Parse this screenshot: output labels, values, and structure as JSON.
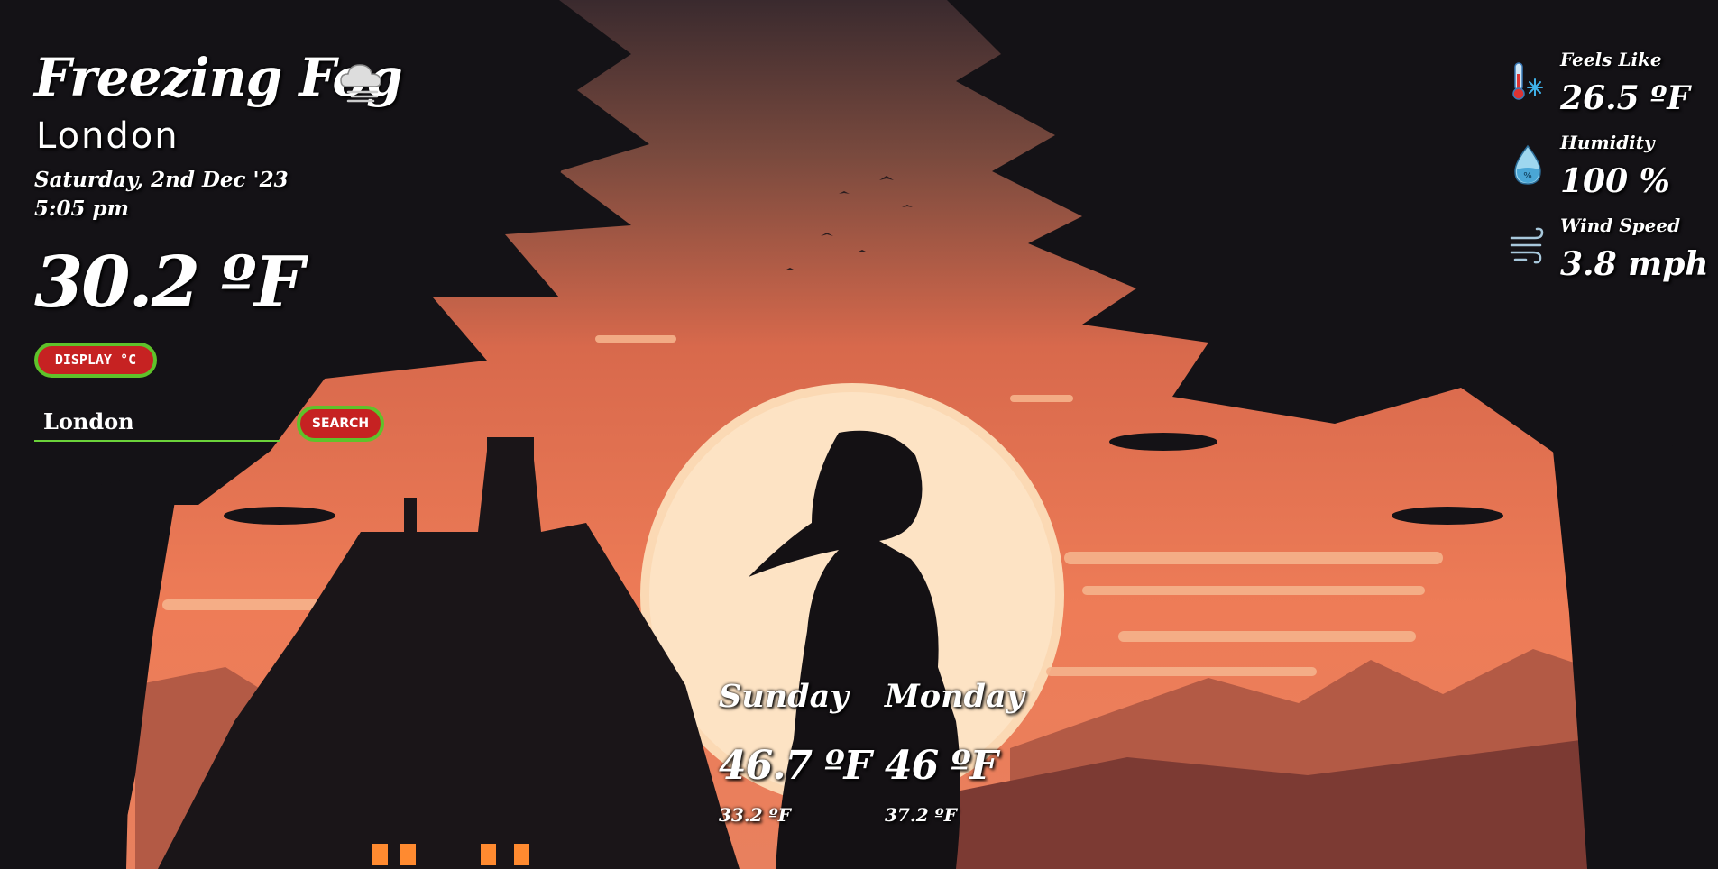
{
  "weather": {
    "condition": "Freezing Fog",
    "condition_icon": "cloud-fog-icon",
    "city": "London",
    "date": "Saturday, 2nd Dec '23",
    "time": "5:05 pm",
    "temperature": "30.2 ºF"
  },
  "controls": {
    "unit_toggle_label": "DISPLAY °C",
    "search_value": "London",
    "search_button_label": "SEARCH"
  },
  "details": [
    {
      "icon": "thermometer-snowflake-icon",
      "label": "Feels Like",
      "value": "26.5 ºF"
    },
    {
      "icon": "humidity-drop-icon",
      "label": "Humidity",
      "value": "100 %"
    },
    {
      "icon": "wind-icon",
      "label": "Wind Speed",
      "value": "3.8 mph"
    }
  ],
  "forecast": [
    {
      "day": "Sunday",
      "high": "46.7 ºF",
      "low": "33.2 ºF"
    },
    {
      "day": "Monday",
      "high": "46 ºF",
      "low": "37.2 ºF"
    }
  ],
  "colors": {
    "sky": "#e8704f",
    "sun": "#fde3c4",
    "silhouette": "#151318",
    "button": "#c62222",
    "button_border": "#5fc22a",
    "input_underline": "#6bd23a"
  }
}
